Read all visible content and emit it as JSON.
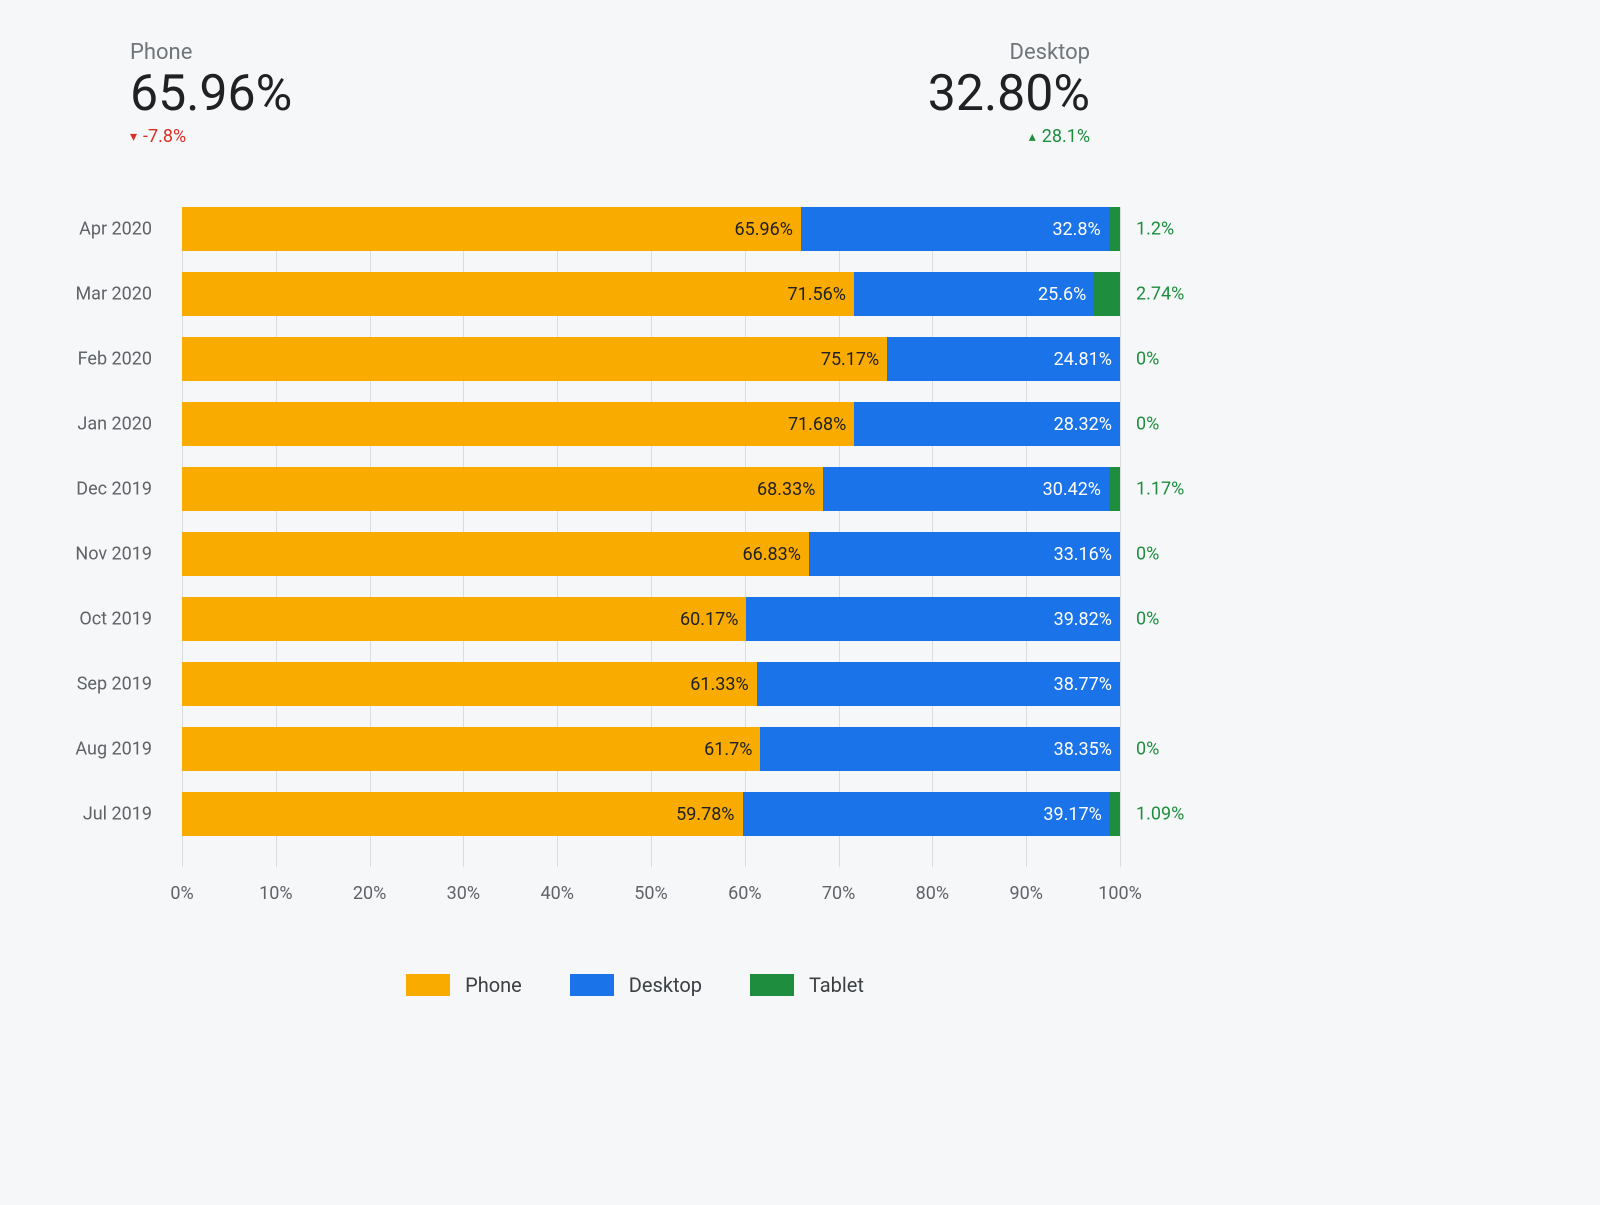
{
  "stats": {
    "phone": {
      "label": "Phone",
      "value": "65.96%",
      "delta": "-7.8%",
      "dir": "down"
    },
    "desktop": {
      "label": "Desktop",
      "value": "32.80%",
      "delta": "28.1%",
      "dir": "up"
    }
  },
  "legend": {
    "phone": "Phone",
    "desktop": "Desktop",
    "tablet": "Tablet"
  },
  "xaxis_ticks": [
    "0%",
    "10%",
    "20%",
    "30%",
    "40%",
    "50%",
    "60%",
    "70%",
    "80%",
    "90%",
    "100%"
  ],
  "chart_data": {
    "type": "bar",
    "stacked": true,
    "orientation": "horizontal",
    "xlabel": "",
    "ylabel": "",
    "xlim": [
      0,
      100
    ],
    "categories": [
      "Apr 2020",
      "Mar 2020",
      "Feb 2020",
      "Jan 2020",
      "Dec 2019",
      "Nov 2019",
      "Oct 2019",
      "Sep 2019",
      "Aug 2019",
      "Jul 2019"
    ],
    "series": [
      {
        "name": "Phone",
        "color": "#f9ab00",
        "values": [
          65.96,
          71.56,
          75.17,
          71.68,
          68.33,
          66.83,
          60.17,
          61.33,
          61.7,
          59.78
        ],
        "value_labels": [
          "65.96%",
          "71.56%",
          "75.17%",
          "71.68%",
          "68.33%",
          "66.83%",
          "60.17%",
          "61.33%",
          "61.7%",
          "59.78%"
        ]
      },
      {
        "name": "Desktop",
        "color": "#1a73e8",
        "values": [
          32.8,
          25.6,
          24.81,
          28.32,
          30.42,
          33.16,
          39.82,
          38.77,
          38.35,
          39.17
        ],
        "value_labels": [
          "32.8%",
          "25.6%",
          "24.81%",
          "28.32%",
          "30.42%",
          "33.16%",
          "39.82%",
          "38.77%",
          "38.35%",
          "39.17%"
        ]
      },
      {
        "name": "Tablet",
        "color": "#1e8e3e",
        "values": [
          1.2,
          2.74,
          0.0,
          0.0,
          1.17,
          0.0,
          0.0,
          0.0,
          0.0,
          1.09
        ],
        "value_labels": [
          "1.2%",
          "2.74%",
          "0%",
          "0%",
          "1.17%",
          "0%",
          "0%",
          "",
          "0%",
          "1.09%"
        ]
      }
    ]
  }
}
